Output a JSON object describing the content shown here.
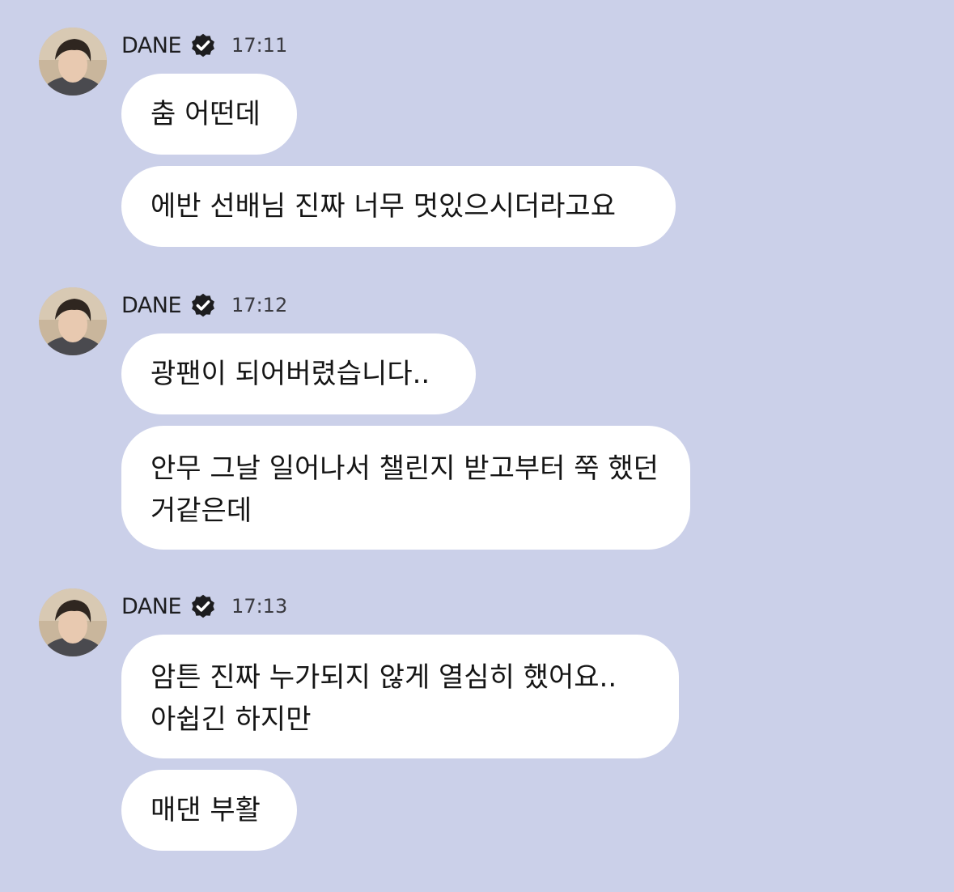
{
  "colors": {
    "background": "#cbd0e9",
    "bubble": "#ffffff",
    "verified_badge": "#1d1d1f"
  },
  "groups": [
    {
      "sender": "DANE",
      "verified_icon": "verified-badge-icon",
      "time": "17:11",
      "messages": [
        "춤 어떤데",
        "에반 선배님 진짜 너무 멋있으시더라고요"
      ]
    },
    {
      "sender": "DANE",
      "verified_icon": "verified-badge-icon",
      "time": "17:12",
      "messages": [
        "광팬이 되어버렸습니다..",
        "안무 그날 일어나서 챌린지 받고부터 쭉 했던거같은데"
      ]
    },
    {
      "sender": "DANE",
      "verified_icon": "verified-badge-icon",
      "time": "17:13",
      "messages": [
        "암튼 진짜 누가되지 않게 열심히 했어요.. 아쉽긴 하지만",
        "매댄 부활"
      ]
    }
  ]
}
